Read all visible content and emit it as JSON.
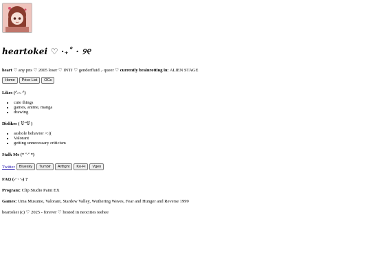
{
  "site": {
    "title": "heartokei ♡ ·₊˚ · ୨୧",
    "intro_heart": "heart",
    "intro_rest": " ♡ any pns ♡ 2005 loser ♡ INTJ ♡ genderfluid ⸝ queer ♡ ",
    "intro_brainrot_label": "currently brainrotting in:",
    "intro_brainrot_value": " ALIEN STAGE"
  },
  "nav": {
    "home": "Home",
    "price_list": "Price List",
    "ocs": "OCs"
  },
  "likes": {
    "heading": "Likes (ᐟ˶ᵕ˶ ᐟ)",
    "items": [
      "cute things",
      "games, anime, manga",
      "drawing"
    ]
  },
  "dislikes": {
    "heading": "Dislikes ( ꒦ ᷄ ᷅꒦ )",
    "items": [
      "asshole behavior >:((",
      "Valorant",
      "getting unnecessary criticism"
    ]
  },
  "stalk": {
    "heading": "Stalk Me (* ˘ᵕ˘ *)",
    "twitter": "Twitter",
    "buttons": [
      "Bluesky",
      "Tumblr",
      "Artfight",
      "Ko-Fi",
      "Vgen"
    ]
  },
  "faq": {
    "heading": "FAQ (˶ᵔ ᵕ ᵔ˶) ?",
    "program_label": "Program:",
    "program_value": " Clip Studio Paint EX",
    "games_label": "Games:",
    "games_value": " Uma Musume, Valorant, Stardew Valley, Wuthering Waves, Fear and Hunger and Reverse 1999"
  },
  "footer": {
    "text": "heartokei (c) ♡ 2025 - forever ♡ hosted in neocities teehee"
  },
  "colors": {
    "link": "#1a0dab",
    "avatar_bg": "#e9b0a8",
    "hair": "#7a3a2c"
  }
}
